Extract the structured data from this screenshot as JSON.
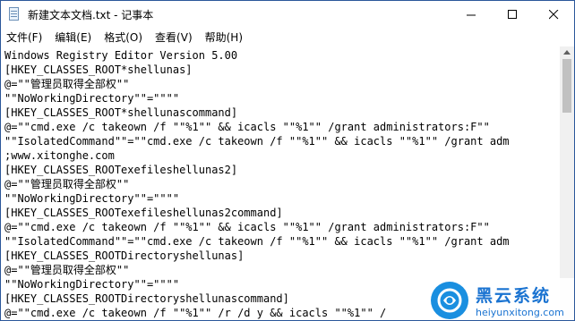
{
  "window": {
    "title": "新建文本文档.txt - 记事本",
    "controls": {
      "minimize": "—",
      "maximize": "☐",
      "close": "✕"
    }
  },
  "menu": {
    "items": [
      "文件(F)",
      "编辑(E)",
      "格式(O)",
      "查看(V)",
      "帮助(H)"
    ]
  },
  "editor": {
    "lines": [
      "Windows Registry Editor Version 5.00",
      "[HKEY_CLASSES_ROOT*shellunas]",
      "@=\"\"管理员取得全部权\"\"",
      "\"\"NoWorkingDirectory\"\"=\"\"\"\"",
      "[HKEY_CLASSES_ROOT*shellunascommand]",
      "@=\"\"cmd.exe /c takeown /f \"\"%1\"\" && icacls \"\"%1\"\" /grant administrators:F\"\"",
      "\"\"IsolatedCommand\"\"=\"\"cmd.exe /c takeown /f \"\"%1\"\" && icacls \"\"%1\"\" /grant adm",
      ";www.xitonghe.com",
      "[HKEY_CLASSES_ROOTexefileshellunas2]",
      "@=\"\"管理员取得全部权\"\"",
      "\"\"NoWorkingDirectory\"\"=\"\"\"\"",
      "[HKEY_CLASSES_ROOTexefileshellunas2command]",
      "@=\"\"cmd.exe /c takeown /f \"\"%1\"\" && icacls \"\"%1\"\" /grant administrators:F\"\"",
      "\"\"IsolatedCommand\"\"=\"\"cmd.exe /c takeown /f \"\"%1\"\" && icacls \"\"%1\"\" /grant adm",
      "[HKEY_CLASSES_ROOTDirectoryshellunas]",
      "@=\"\"管理员取得全部权\"\"",
      "\"\"NoWorkingDirectory\"\"=\"\"\"\"",
      "[HKEY_CLASSES_ROOTDirectoryshellunascommand]",
      "@=\"\"cmd.exe /c takeown /f \"\"%1\"\" /r /d y && icacls \"\"%1\"\" /"
    ]
  },
  "watermark": {
    "name": "黑云系统",
    "url": "heiyunxitong.com"
  },
  "colors": {
    "window_border": "#2b579a",
    "watermark_blue": "#1a73d1"
  }
}
